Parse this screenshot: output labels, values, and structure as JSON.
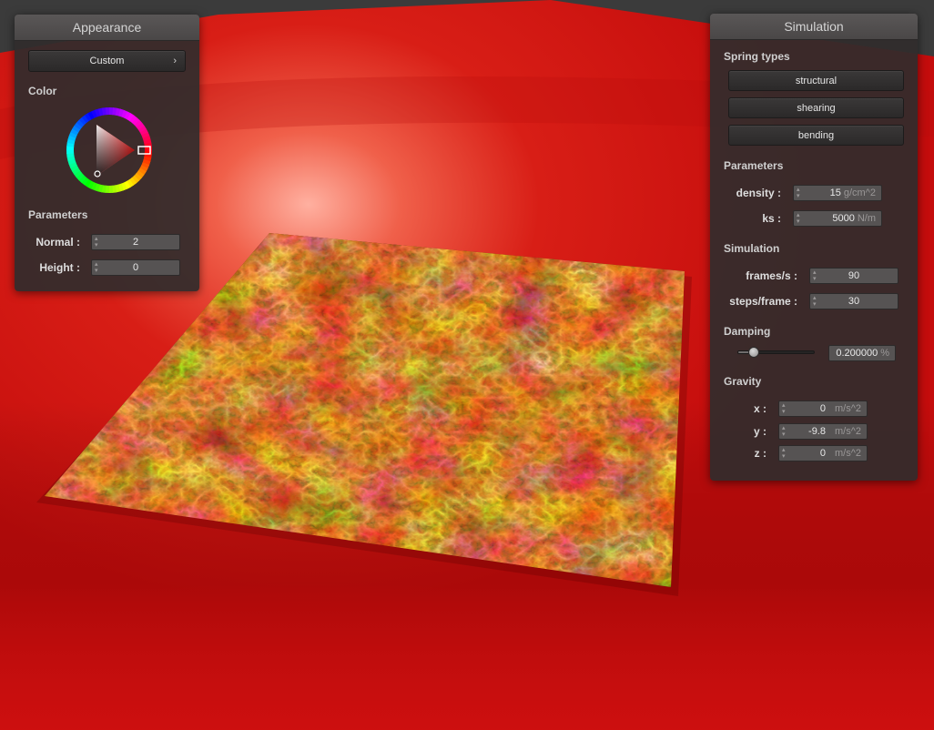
{
  "appearance": {
    "title": "Appearance",
    "preset": {
      "label": "Custom",
      "arrow": "›"
    },
    "color_label": "Color",
    "color_hue": "#e01e1e",
    "parameters_label": "Parameters",
    "fields": [
      {
        "label": "Normal :",
        "value": "2"
      },
      {
        "label": "Height :",
        "value": "0"
      }
    ]
  },
  "simulation": {
    "title": "Simulation",
    "spring_types_label": "Spring types",
    "spring_buttons": [
      "structural",
      "shearing",
      "bending"
    ],
    "parameters_label": "Parameters",
    "parameters": [
      {
        "label": "density :",
        "value": "15",
        "unit": "g/cm^2"
      },
      {
        "label": "ks :",
        "value": "5000",
        "unit": "N/m"
      }
    ],
    "sim_label": "Simulation",
    "sim_fields": [
      {
        "label": "frames/s :",
        "value": "90"
      },
      {
        "label": "steps/frame :",
        "value": "30"
      }
    ],
    "damping_label": "Damping",
    "damping": {
      "value": "0.200000",
      "unit": "%",
      "slider_level": 0.2
    },
    "gravity_label": "Gravity",
    "gravity": [
      {
        "label": "x :",
        "value": "0",
        "unit": "m/s^2"
      },
      {
        "label": "y :",
        "value": "-9.8",
        "unit": "m/s^2"
      },
      {
        "label": "z :",
        "value": "0",
        "unit": "m/s^2"
      }
    ]
  },
  "scene": {
    "background_color": "#3b3b3b",
    "floor_color": "#d21414",
    "cloth_texture": "lava",
    "cloth_colors": [
      "#2a0502",
      "#8a1a08",
      "#e04a10",
      "#ffb830",
      "#ffe890"
    ]
  }
}
